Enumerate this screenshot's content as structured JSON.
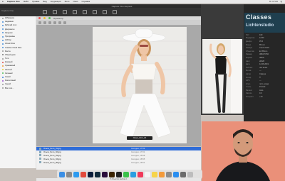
{
  "menubar": {
    "apple": "",
    "items": [
      "Capture One",
      "Файл",
      "Правка",
      "Вид",
      "Коррекция",
      "Фото",
      "Окно",
      "Справка"
    ],
    "right_items": [
      "Пт 17:04",
      "Q"
    ]
  },
  "window": {
    "title": "Capture One Express",
    "app_label": "Capture One"
  },
  "sidebar": {
    "items": [
      {
        "label": "Избранное",
        "color": "#999"
      },
      {
        "label": "Недавние",
        "color": "#4a90d9"
      },
      {
        "label": "Рабочий стол",
        "color": "#4a90d9"
      },
      {
        "label": "Документы",
        "color": "#4a90d9"
      },
      {
        "label": "Загрузки",
        "color": "#4a90d9"
      },
      {
        "label": "Программы",
        "color": "#4a90d9"
      },
      {
        "label": "AirDrop",
        "color": "#4a90d9"
      },
      {
        "label": "iCloud Drive",
        "color": "#4a90d9"
      },
      {
        "label": "Creative Cloud Files",
        "color": "#4a90d9"
      },
      {
        "label": "Места",
        "color": "#999"
      },
      {
        "label": "Общий диск",
        "color": "#777"
      },
      {
        "label": "Теги",
        "color": "#999"
      },
      {
        "label": "Красный",
        "color": "#e24c4c"
      },
      {
        "label": "Оранжевый",
        "color": "#f29a38"
      },
      {
        "label": "Желтый",
        "color": "#e8cf3a"
      },
      {
        "label": "Зеленый",
        "color": "#4fbf5a"
      },
      {
        "label": "Синий",
        "color": "#3a7ae0"
      },
      {
        "label": "Фиолетовый",
        "color": "#a05ad0"
      },
      {
        "label": "Серый",
        "color": "#999"
      },
      {
        "label": "Все теги…",
        "color": "#999"
      }
    ]
  },
  "viewer": {
    "label": "Просмотр",
    "caption": "Ольга_Лето_01"
  },
  "filelist": {
    "rows": [
      {
        "name": "Ольга_Лето_01.jpg",
        "date": "Сегодня, 17:02",
        "selected": true
      },
      {
        "name": "Ольга_Лето_02.jpg",
        "date": "Сегодня, 17:01",
        "selected": false
      },
      {
        "name": "Ольга_Лето_03.jpg",
        "date": "Сегодня, 16:58",
        "selected": false
      },
      {
        "name": "Ольга_Лето_04.jpg",
        "date": "Сегодня, 16:55",
        "selected": false
      },
      {
        "name": "Ольга_Лето_05.jpg",
        "date": "Сегодня, 16:51",
        "selected": false
      }
    ]
  },
  "statusbar": {
    "text": "5 объектов, выбран 1"
  },
  "panel": {
    "brand_line1": "Classes",
    "brand_line2": "Lichtenstudio",
    "rows": [
      {
        "k": "ISO",
        "v": "100"
      },
      {
        "k": "Выдержка",
        "v": "1/160"
      },
      {
        "k": "Диафр.",
        "v": "f/5.6"
      },
      {
        "k": "Фокус",
        "v": "85 mm"
      },
      {
        "k": "Камера",
        "v": "Canon EOS"
      },
      {
        "k": "Объектив",
        "v": "EF 85mm"
      },
      {
        "k": "Размер",
        "v": "3840×5760"
      },
      {
        "k": "Формат",
        "v": "JPEG"
      },
      {
        "k": "Цвет",
        "v": "sRGB"
      },
      {
        "k": "Дата",
        "v": "12.06.2019"
      },
      {
        "k": "Рейтинг",
        "v": "★★★★★"
      },
      {
        "k": "Метка",
        "v": "—"
      },
      {
        "k": "Автор",
        "v": "Classes"
      },
      {
        "k": "Копир.",
        "v": "©"
      },
      {
        "k": "GPS",
        "v": "—"
      },
      {
        "k": "Ключ.",
        "v": "лето, мода"
      },
      {
        "k": "Стиль",
        "v": "Portrait"
      },
      {
        "k": "Баланс",
        "v": "Auto"
      },
      {
        "k": "Экспоз.",
        "v": "0.0"
      },
      {
        "k": "Контраст",
        "v": "+10"
      }
    ]
  },
  "dock": {
    "icons": [
      {
        "name": "finder-icon",
        "color": "#3b8fe5"
      },
      {
        "name": "launchpad-icon",
        "color": "#8a8a8a"
      },
      {
        "name": "safari-icon",
        "color": "#2d9bf0"
      },
      {
        "name": "chrome-icon",
        "color": "#e24a3b"
      },
      {
        "name": "photoshop-icon",
        "color": "#0b1d3a"
      },
      {
        "name": "lightroom-icon",
        "color": "#102a3b"
      },
      {
        "name": "premiere-icon",
        "color": "#2a0b3b"
      },
      {
        "name": "illustrator-icon",
        "color": "#3b2300"
      },
      {
        "name": "capture-one-icon",
        "color": "#222"
      },
      {
        "name": "messages-icon",
        "color": "#3ac24a"
      },
      {
        "name": "telegram-icon",
        "color": "#2a9ee0"
      },
      {
        "name": "music-icon",
        "color": "#f03a5a"
      },
      {
        "name": "calendar-icon",
        "color": "#f4f4f4"
      },
      {
        "name": "notes-icon",
        "color": "#f6d44a"
      },
      {
        "name": "photos-icon",
        "color": "#f39a3a"
      },
      {
        "name": "settings-icon",
        "color": "#8c8c8c"
      },
      {
        "name": "appstore-icon",
        "color": "#2a8ef0"
      },
      {
        "name": "downloads-icon",
        "color": "#6b6b6b"
      },
      {
        "name": "trash-icon",
        "color": "#bdbdbd"
      }
    ]
  },
  "colors": {
    "accent": "#2f6dd8",
    "panel": "#262626",
    "brand": "#1f3f4f"
  }
}
